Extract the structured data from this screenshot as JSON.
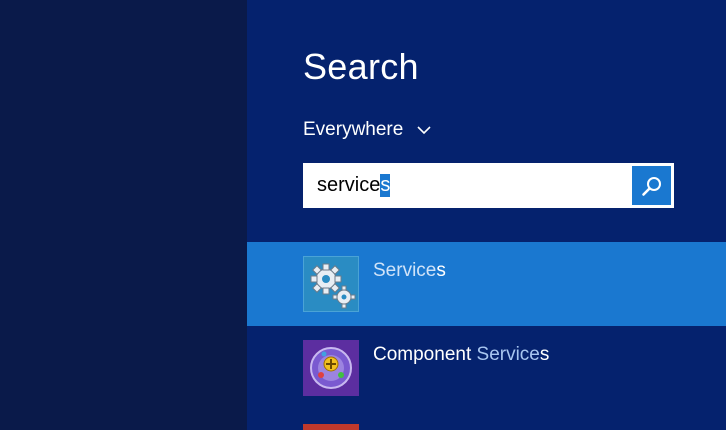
{
  "search": {
    "title": "Search",
    "scope_label": "Everywhere",
    "query_prefix": "service",
    "query_selected": "s"
  },
  "results": [
    {
      "name_plain": "",
      "name_match": "Service",
      "name_suffix": "s",
      "icon": "gears-icon",
      "selected": true
    },
    {
      "name_plain": "Component ",
      "name_match": "Service",
      "name_suffix": "s",
      "icon": "component-services-icon",
      "selected": false
    }
  ],
  "colors": {
    "pane_bg": "#05226e",
    "left_bg": "#0a1a4a",
    "accent": "#1a78d0",
    "match_text": "#a8c6f0"
  }
}
